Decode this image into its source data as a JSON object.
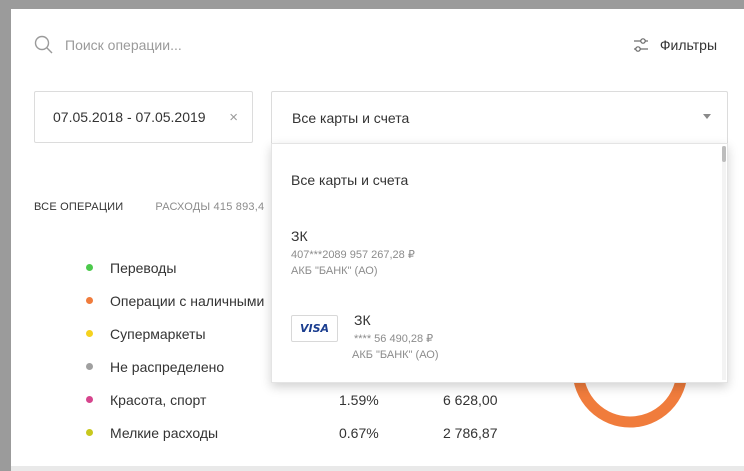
{
  "search": {
    "placeholder": "Поиск операции..."
  },
  "filters": {
    "label": "Фильтры",
    "icon": "sliders-icon"
  },
  "date_range": {
    "value": "07.05.2018 - 07.05.2019",
    "clear": "×"
  },
  "account_select": {
    "selected": "Все карты и счета"
  },
  "tabs": {
    "all": "ВСЕ ОПЕРАЦИИ",
    "expenses": "РАСХОДЫ 415 893,4"
  },
  "categories": [
    {
      "name": "Переводы",
      "color": "#4cc94c",
      "pct": "",
      "sum": ""
    },
    {
      "name": "Операции с наличными",
      "color": "#f07c3c",
      "pct": "",
      "sum": ""
    },
    {
      "name": "Супермаркеты",
      "color": "#f5d21e",
      "pct": "",
      "sum": ""
    },
    {
      "name": "Не распределено",
      "color": "#a0a0a0",
      "pct": "",
      "sum": ""
    },
    {
      "name": "Красота, спорт",
      "color": "#d6458d",
      "pct": "1.59%",
      "sum": "6 628,00"
    },
    {
      "name": "Мелкие расходы",
      "color": "#c8c81e",
      "pct": "0.67%",
      "sum": "2 786,87"
    }
  ],
  "dropdown": {
    "option_all": "Все карты и счета",
    "accounts": [
      {
        "title": "ЗК",
        "line1": "407***2089 957 267,28 ₽",
        "line2": "АКБ \"БАНК\" (АО)"
      },
      {
        "title": "ЗК",
        "line1": "**** 56 490,28 ₽",
        "line2": "АКБ \"БАНК\" (АО)",
        "logo": "VISA"
      }
    ]
  },
  "colors": {
    "donut_orange": "#f07c3c",
    "donut_green": "#4cc94c"
  }
}
